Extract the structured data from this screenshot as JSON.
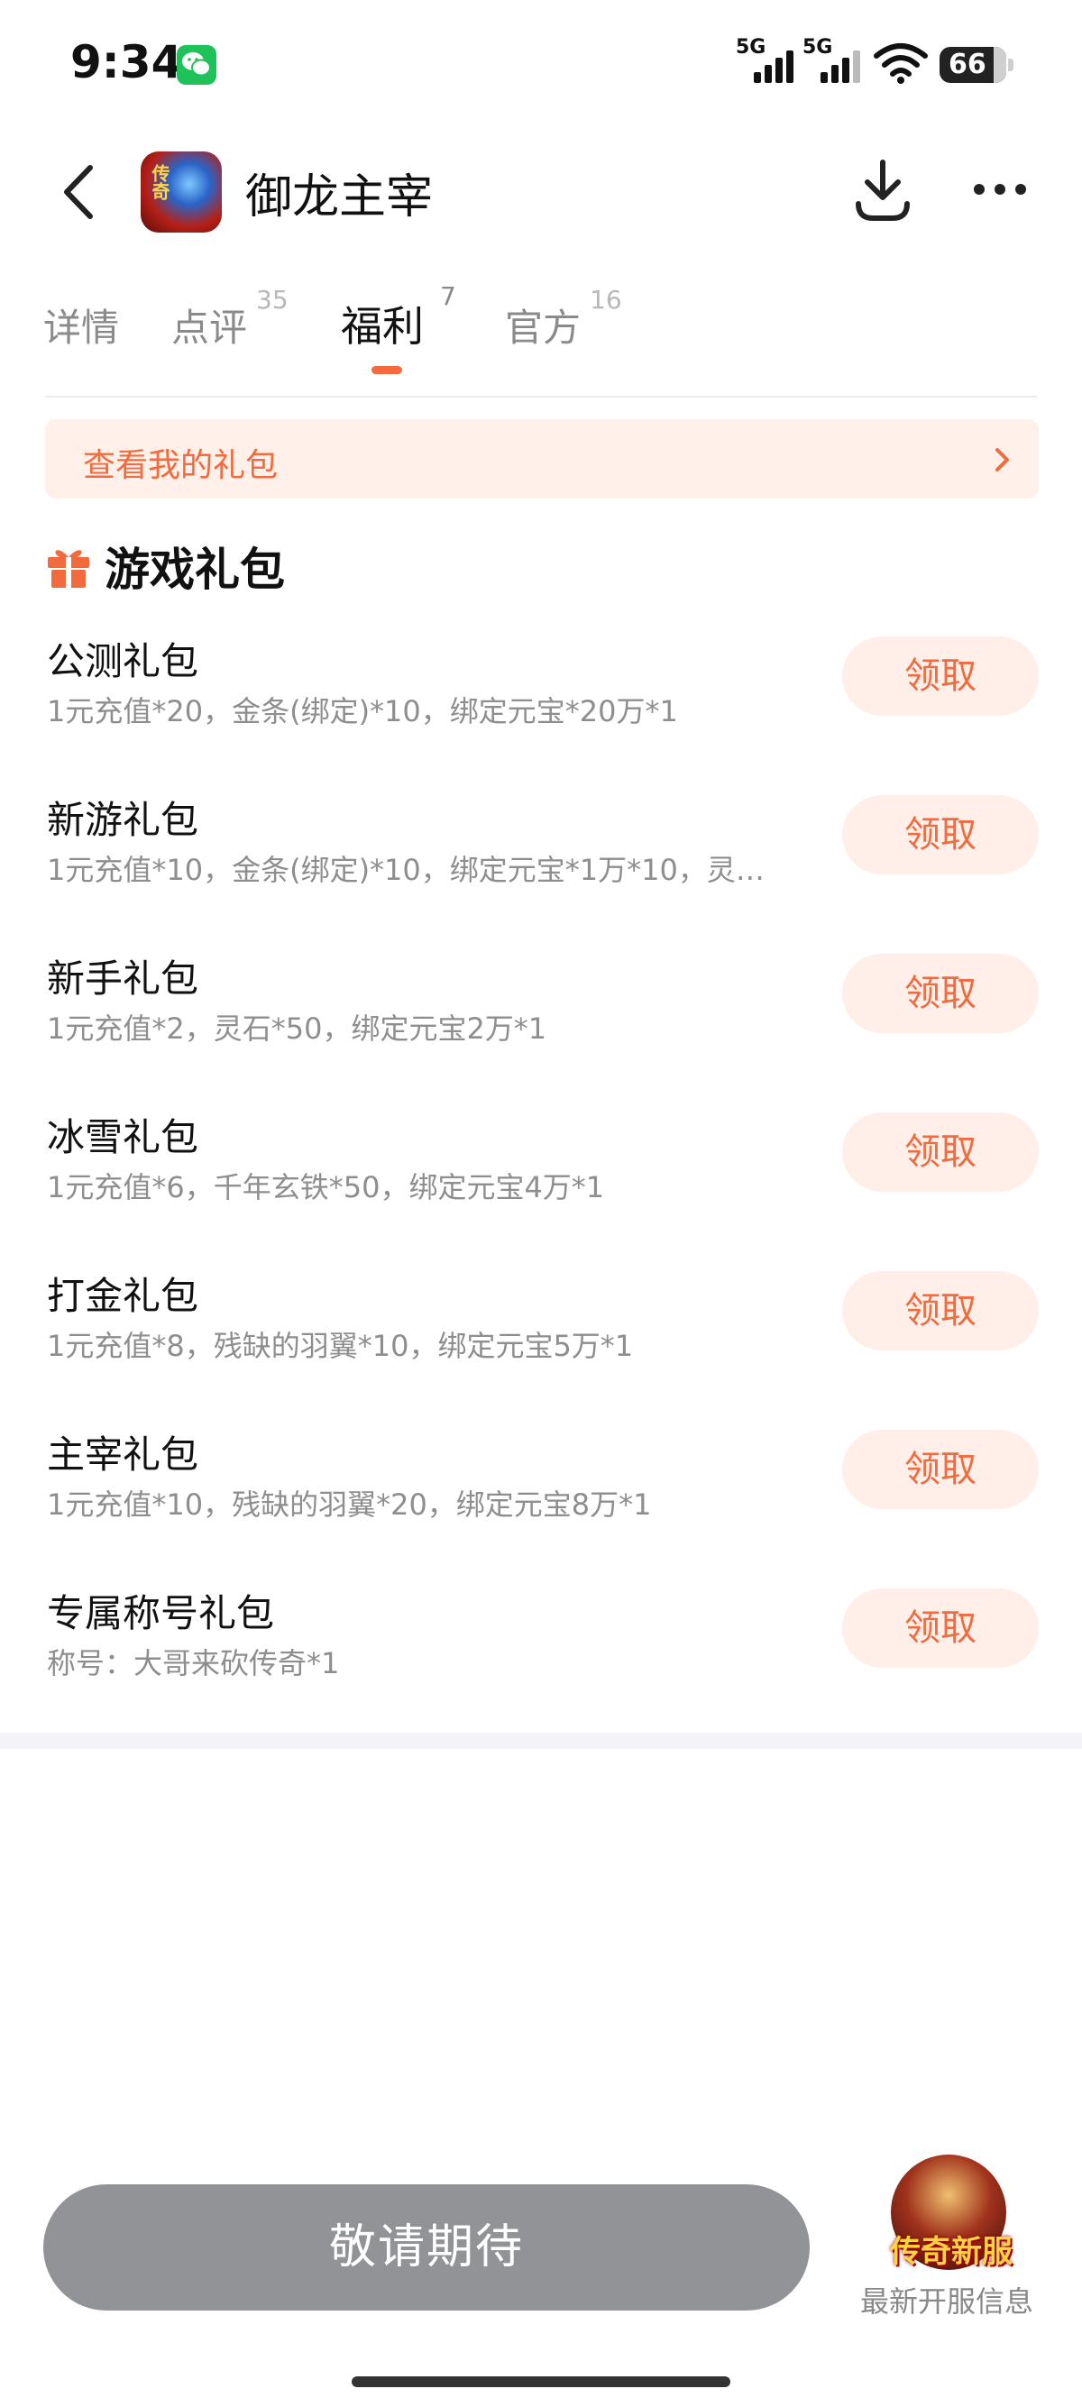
{
  "status_bar": {
    "time": "9:34",
    "signal1_label": "5G",
    "signal2_label": "5G",
    "battery": "66",
    "icons": [
      "wechat-icon",
      "signal-icon",
      "signal-icon",
      "wifi-icon",
      "battery-icon"
    ]
  },
  "header": {
    "app_name": "御龙主宰",
    "app_icon_text": "传奇",
    "icons": [
      "back-icon",
      "download-icon",
      "more-icon"
    ]
  },
  "tabs": [
    {
      "label": "详情",
      "count": ""
    },
    {
      "label": "点评",
      "count": "35"
    },
    {
      "label": "福利",
      "count": "7",
      "active": true
    },
    {
      "label": "官方",
      "count": "16"
    }
  ],
  "my_gifts_link": "查看我的礼包",
  "section_title": "游戏礼包",
  "gifts": [
    {
      "name": "公测礼包",
      "desc": "1元充值*20，金条(绑定)*10，绑定元宝*20万*1",
      "button": "领取"
    },
    {
      "name": "新游礼包",
      "desc": "1元充值*10，金条(绑定)*10，绑定元宝*1万*10，灵…",
      "button": "领取"
    },
    {
      "name": "新手礼包",
      "desc": "1元充值*2，灵石*50，绑定元宝2万*1",
      "button": "领取"
    },
    {
      "name": "冰雪礼包",
      "desc": "1元充值*6，千年玄铁*50，绑定元宝4万*1",
      "button": "领取"
    },
    {
      "name": "打金礼包",
      "desc": "1元充值*8，残缺的羽翼*10，绑定元宝5万*1",
      "button": "领取"
    },
    {
      "name": "主宰礼包",
      "desc": "1元充值*10，残缺的羽翼*20，绑定元宝8万*1",
      "button": "领取"
    },
    {
      "name": "专属称号礼包",
      "desc": "称号：大哥来砍传奇*1",
      "button": "领取"
    }
  ],
  "bottom": {
    "cta_label": "敬请期待",
    "new_server_badge": "传奇新服",
    "new_server_label": "最新开服信息"
  },
  "colors": {
    "accent": "#f26a3d",
    "accent_bg": "#ffefe8",
    "cta_bg": "#919396"
  }
}
